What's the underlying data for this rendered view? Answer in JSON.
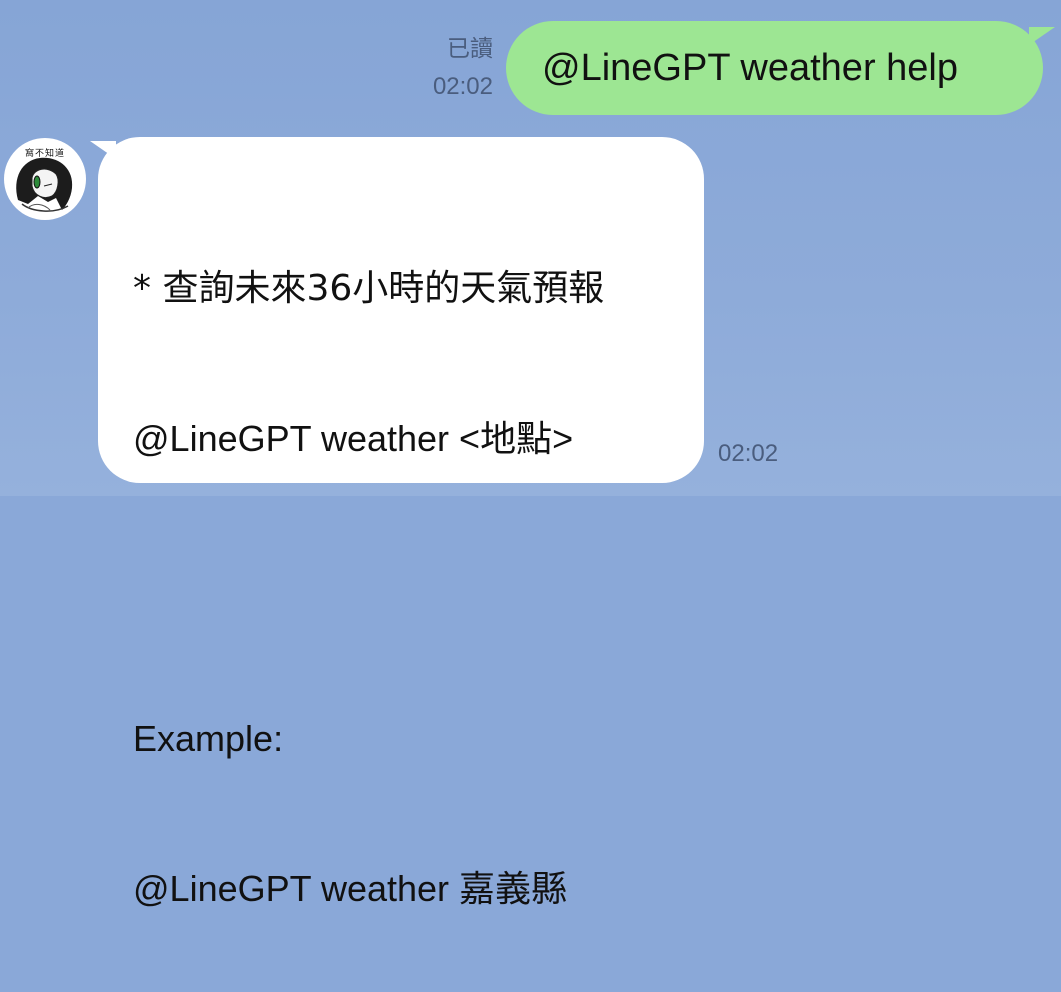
{
  "outgoing": {
    "read_label": "已讀",
    "time": "02:02",
    "text": "@LineGPT weather help"
  },
  "incoming": {
    "avatar_label": "窩不知道",
    "lines": [
      "* 查詢未來36小時的天氣預報",
      "@LineGPT weather <地點>",
      "",
      "Example:",
      "@LineGPT weather 嘉義縣"
    ],
    "time": "02:02"
  },
  "colors": {
    "background": "#8aa8d8",
    "outgoing_bubble": "#9de693",
    "incoming_bubble": "#ffffff",
    "meta_text": "#4a5d7e"
  }
}
